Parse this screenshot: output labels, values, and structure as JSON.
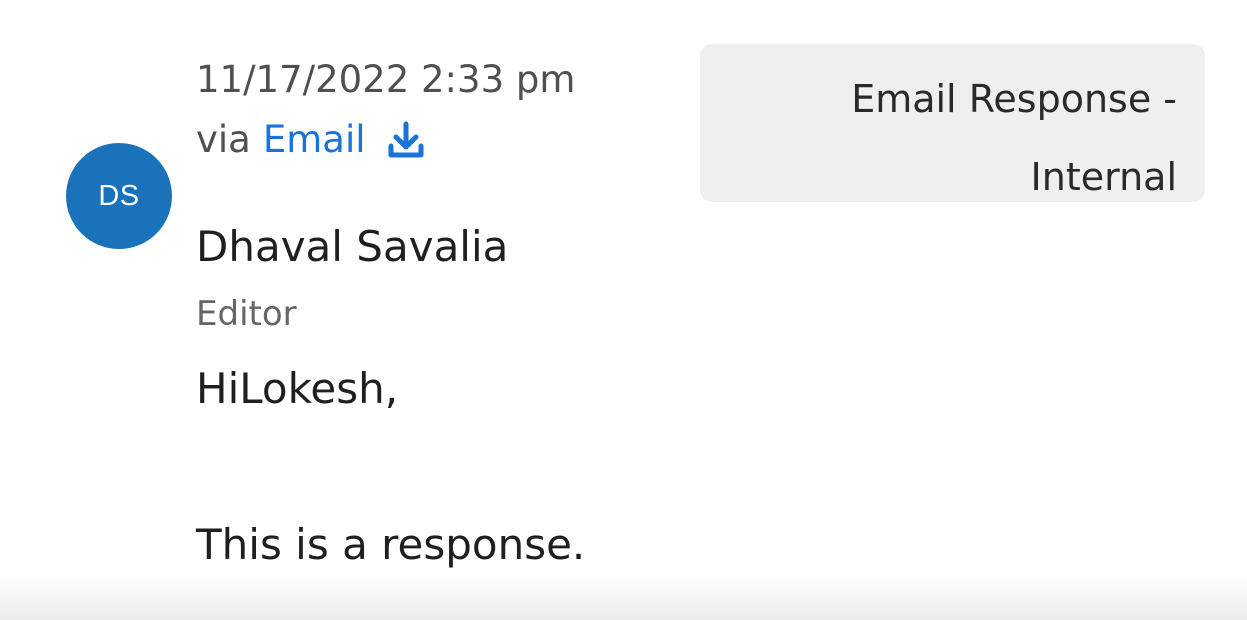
{
  "message": {
    "avatar_initials": "DS",
    "timestamp": "11/17/2022 2:33 pm",
    "via_label": "via",
    "channel": "Email",
    "sender_name": "Dhaval Savalia",
    "sender_role": "Editor",
    "body_greeting": "HiLokesh,",
    "body_text": "This is a response."
  },
  "tag": {
    "label": "Email Response - Internal"
  },
  "icons": {
    "download": "download-icon"
  },
  "colors": {
    "avatar_bg": "#1a72bb",
    "link": "#1a73d9",
    "tag_bg": "#efefef"
  }
}
